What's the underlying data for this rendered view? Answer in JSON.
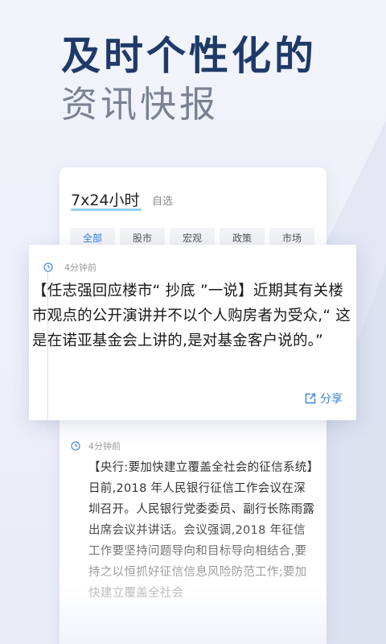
{
  "hero": {
    "line1": "及时个性化的",
    "line2": "资讯快报"
  },
  "tabs": {
    "main": "7x24小时",
    "sub": "自选"
  },
  "chips": [
    "全部",
    "股市",
    "宏观",
    "政策",
    "市场"
  ],
  "popup": {
    "time": "4分钟前",
    "text": "【任志强回应楼市“ 抄底 ”一说】近期其有关楼市观点的公开演讲并不以个人购房者为受众,“ 这是在诺亚基金会上讲的,是对基金客户说的。”",
    "share_label": "分享"
  },
  "feed": {
    "time": "4分钟前",
    "text": "【央行:要加快建立覆盖全社会的征信系统】日前,2018 年人民银行征信工作会议在深圳召开。人民银行党委委员、副行长陈雨露出席会议并讲话。会议强调,2018 年征信工作要坚持问题导向和目标导向相结合,要持之以恒抓好征信信息风险防范工作;要加快建立覆盖全社会"
  },
  "colors": {
    "hero_title": "#1f3a68",
    "hero_subtitle": "#7a8292",
    "accent": "#3a86d8",
    "tab_underline": "#8fd1f0"
  },
  "icons": {
    "clock": "clock-icon",
    "share": "share-icon"
  }
}
